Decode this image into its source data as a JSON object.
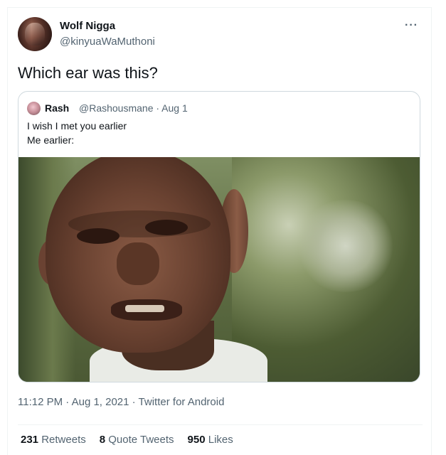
{
  "tweet": {
    "display_name": "Wolf Nigga",
    "handle": "@kinyuaWaMuthoni",
    "more_icon": "more-horizontal-icon",
    "more_glyph": "···",
    "text": "Which ear was this?",
    "timestamp": "11:12 PM · Aug 1, 2021 · Twitter for Android"
  },
  "quote": {
    "display_name": "Rash",
    "handle_and_date": "@Rashousmane · Aug 1",
    "line1": "I wish I met you earlier",
    "line2": "Me earlier:"
  },
  "stats": [
    {
      "count": "231",
      "label": "Retweets"
    },
    {
      "count": "8",
      "label": "Quote Tweets"
    },
    {
      "count": "950",
      "label": "Likes"
    }
  ],
  "colors": {
    "text_primary": "#0f1419",
    "text_secondary": "#536471",
    "border": "#cfd9de"
  }
}
